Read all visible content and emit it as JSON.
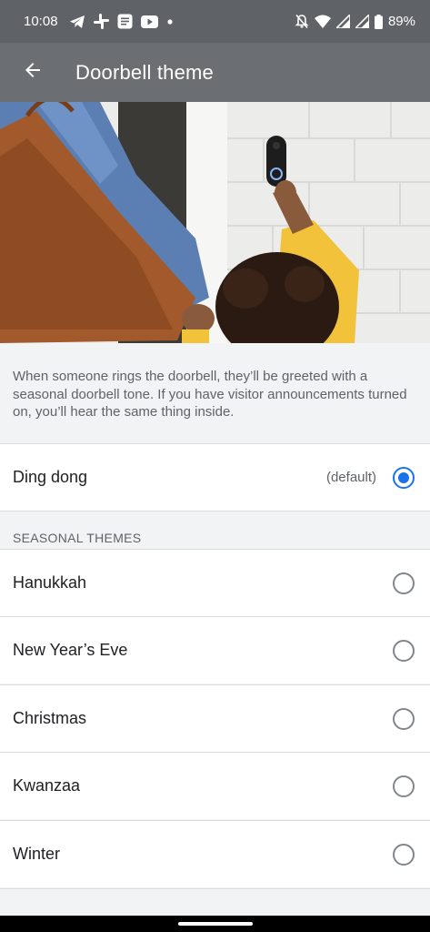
{
  "status_bar": {
    "time": "10:08",
    "battery": "89%",
    "left_icons": [
      "telegram-icon",
      "slack-icon",
      "messages-icon",
      "youtube-icon",
      "notification-dot-icon"
    ],
    "right_icons": [
      "dnd-off-icon",
      "wifi-icon",
      "signal-icon",
      "signal-icon",
      "battery-icon"
    ]
  },
  "app_bar": {
    "title": "Doorbell theme",
    "back_icon": "arrow-left-icon"
  },
  "description": "When someone rings the doorbell, they’ll be greeted with a seasonal doorbell tone. If you have visitor announcements turned on, you’ll hear the same thing inside.",
  "default_option": {
    "label": "Ding dong",
    "hint": "(default)",
    "selected": true
  },
  "seasonal": {
    "header": "SEASONAL THEMES",
    "options": [
      {
        "label": "Hanukkah",
        "selected": false
      },
      {
        "label": "New Year’s Eve",
        "selected": false
      },
      {
        "label": "Christmas",
        "selected": false
      },
      {
        "label": "Kwanzaa",
        "selected": false
      },
      {
        "label": "Winter",
        "selected": false
      }
    ]
  },
  "colors": {
    "accent": "#1a73e8",
    "app_bar": "#6b6e72",
    "status_bar": "#5f6368"
  }
}
